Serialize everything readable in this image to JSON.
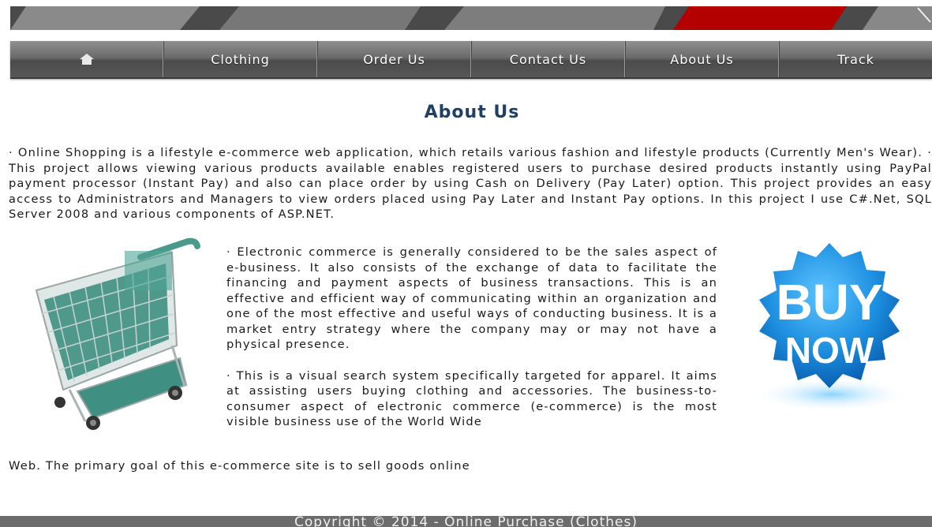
{
  "nav": {
    "home_icon": "home-icon",
    "items": [
      "Clothing",
      "Order Us",
      "Contact Us",
      "About Us",
      "Track"
    ]
  },
  "page_title": "About Us",
  "intro_text": "· Online Shopping is a lifestyle e-commerce web application, which retails various fashion and lifestyle products (Currently Men's Wear). · This project allows viewing various products available enables registered users to purchase desired products instantly using PayPal payment processor (Instant Pay) and also can place order by using Cash on Delivery (Pay Later) option. This project provides an easy access to Administrators and Managers to view orders placed using Pay Later and Instant Pay options. In this project I use C#.Net, SQL Server 2008 and various components of ASP.NET.",
  "paragraph_ecommerce": "· Electronic commerce is generally considered to be the sales aspect of e-business. It also consists of the exchange of data to facilitate the financing and payment aspects of business transactions. This is an effective and efficient way of communicating within an organization and one of the most effective and useful ways of conducting business. It is a market entry strategy where the company may or may not have a physical presence.",
  "paragraph_visual": "· This is a visual search system specifically targeted for apparel. It aims at assisting users buying clothing and accessories. The business-to-consumer aspect of electronic commerce (e-commerce) is the most visible business use of the World Wide",
  "paragraph_tail": "Web. The primary goal of this e-commerce site is to sell goods online",
  "buy_badge": {
    "line1": "BUY",
    "line2": "NOW"
  },
  "footer_text": "Copyright © 2014 - Online Purchase (Clothes)",
  "colors": {
    "title": "#1f3f63",
    "nav": "#6b6b6b",
    "badge": "#1f8fe0"
  }
}
